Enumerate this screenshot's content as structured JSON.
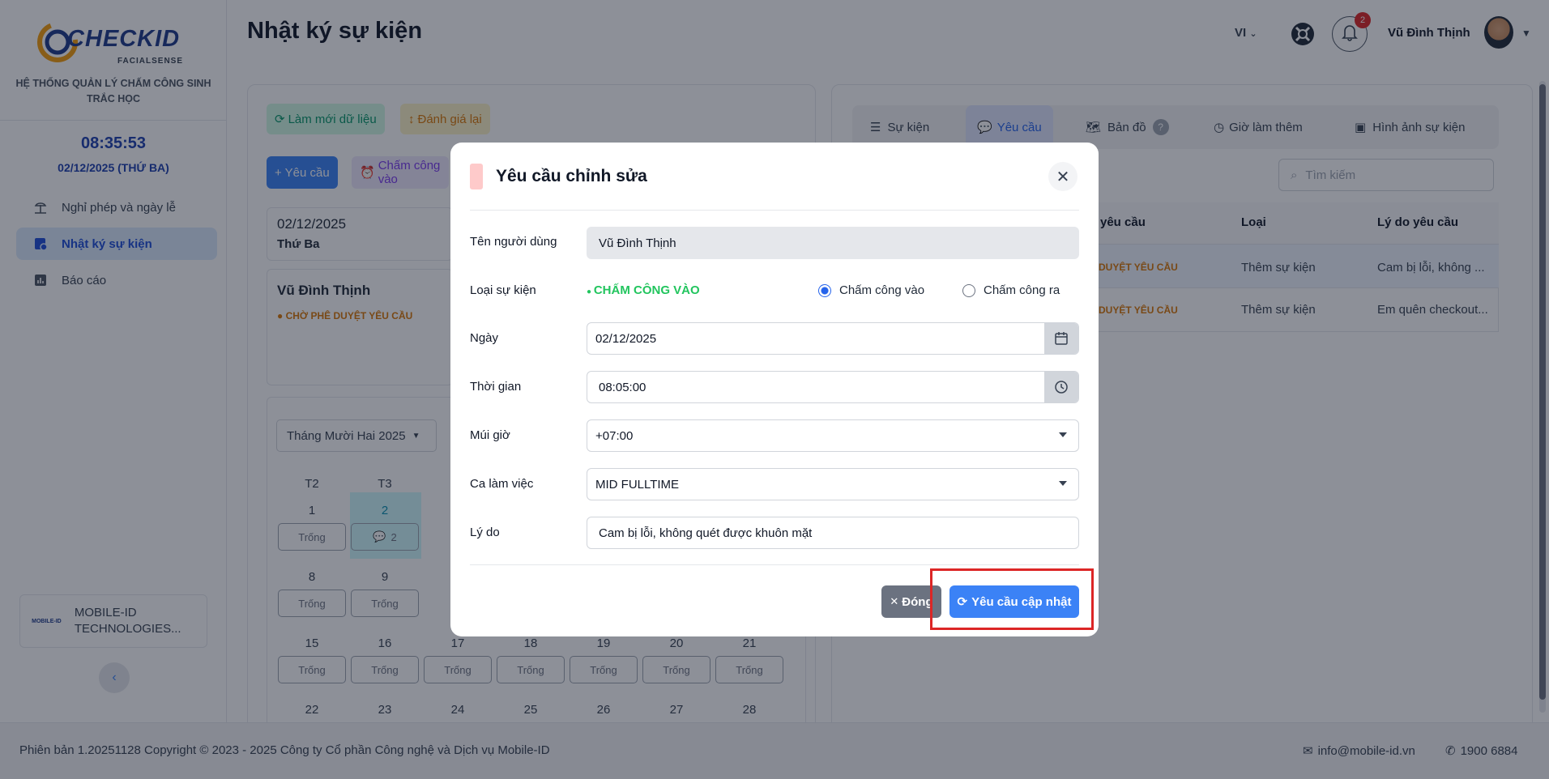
{
  "brand": {
    "logo_text": "CHECKID",
    "logo_sub": "FACIALSENSE",
    "system_title": "HỆ THỐNG QUẢN LÝ CHẤM CÔNG SINH TRẮC HỌC"
  },
  "sidebar": {
    "clock": "08:35:53",
    "date": "02/12/2025 (THỨ BA)",
    "items": [
      {
        "label": "Nghỉ phép và ngày lễ"
      },
      {
        "label": "Nhật ký sự kiện"
      },
      {
        "label": "Báo cáo"
      }
    ],
    "company": "MOBILE-ID TECHNOLOGIES...",
    "company_logo": "MOBILE-ID"
  },
  "header": {
    "title": "Nhật ký sự kiện",
    "lang": "VI",
    "notification_count": "2",
    "user_name": "Vũ Đình Thịnh"
  },
  "left": {
    "refresh_label": "Làm mới dữ liệu",
    "reevaluate_label": "Đánh giá lại",
    "request_label": "+ Yêu cầu",
    "checkin_label": "Chấm công vào",
    "day_date": "02/12/2025",
    "day_name": "Thứ Ba",
    "employee": "Vũ Đình Thịnh",
    "status": "CHỜ PHÊ DUYỆT YÊU CẦU",
    "month": "Tháng Mười Hai 2025",
    "weekdays": [
      "T2",
      "T3"
    ],
    "week1": [
      "1",
      "2"
    ],
    "week1_badge": "2",
    "week2": [
      "8",
      "9"
    ],
    "week3": [
      "15",
      "16",
      "17",
      "18",
      "19",
      "20",
      "21"
    ],
    "week4": [
      "22",
      "23",
      "24",
      "25",
      "26",
      "27",
      "28"
    ],
    "empty": "Trống"
  },
  "right": {
    "tabs": [
      {
        "label": "Sự kiện"
      },
      {
        "label": "Yêu cầu"
      },
      {
        "label": "Bản đồ"
      },
      {
        "label": "Giờ làm thêm"
      },
      {
        "label": "Hình ảnh sự kiện"
      }
    ],
    "search_placeholder": "Tìm kiếm",
    "headers": {
      "status": "yêu cầu",
      "type": "Loại",
      "reason": "Lý do yêu cầu"
    },
    "rows": [
      {
        "status": "DUYỆT YÊU CẦU",
        "type": "Thêm sự kiện",
        "reason": "Cam bị lỗi, không ..."
      },
      {
        "status": "DUYỆT YÊU CẦU",
        "type": "Thêm sự kiện",
        "reason": "Em quên checkout..."
      }
    ]
  },
  "modal": {
    "title": "Yêu cầu chỉnh sửa",
    "user_label": "Tên người dùng",
    "user_value": "Vũ Đình Thịnh",
    "event_type_label": "Loại sự kiện",
    "event_type_value": "CHẤM CÔNG VÀO",
    "radio_in": "Chấm công vào",
    "radio_out": "Chấm công ra",
    "date_label": "Ngày",
    "date_value": "02/12/2025",
    "time_label": "Thời gian",
    "time_value": "08:05:00",
    "tz_label": "Múi giờ",
    "tz_value": "+07:00",
    "shift_label": "Ca làm việc",
    "shift_value": "MID FULLTIME",
    "reason_label": "Lý do",
    "reason_value": "Cam bị lỗi, không quét được khuôn mặt",
    "close_label": "Đóng",
    "submit_label": "Yêu cầu cập nhật"
  },
  "footer": {
    "version": "Phiên bản 1.20251128 Copyright © 2023 - 2025 Công ty Cổ phần Công nghệ và Dịch vụ Mobile-ID",
    "email": "info@mobile-id.vn",
    "phone": "1900 6884"
  },
  "colors": {
    "primary": "#3b82f6",
    "highlight": "#dc2626",
    "status_warning": "#d97706",
    "event_in": "#22c55e"
  }
}
